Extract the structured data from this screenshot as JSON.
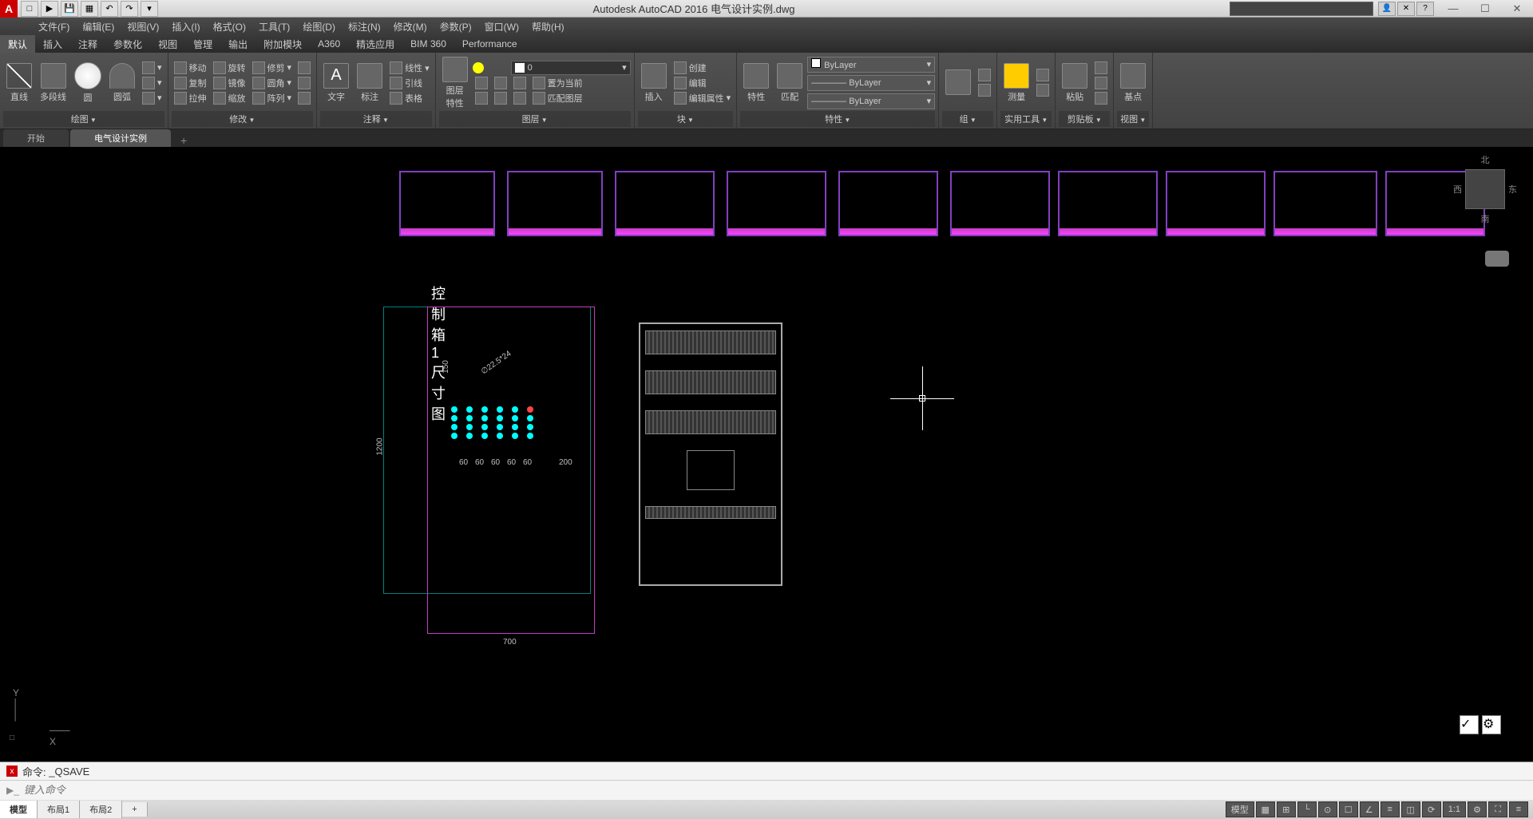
{
  "title": "Autodesk AutoCAD 2016   电气设计实例.dwg",
  "qat": [
    "□",
    "▶",
    "■",
    "▦",
    "↶",
    "↷",
    "▾"
  ],
  "menu": [
    "文件(F)",
    "编辑(E)",
    "视图(V)",
    "插入(I)",
    "格式(O)",
    "工具(T)",
    "绘图(D)",
    "标注(N)",
    "修改(M)",
    "参数(P)",
    "窗口(W)",
    "帮助(H)"
  ],
  "ribbon_tabs": [
    "默认",
    "插入",
    "注释",
    "参数化",
    "视图",
    "管理",
    "输出",
    "附加模块",
    "A360",
    "精选应用",
    "BIM 360",
    "Performance"
  ],
  "active_ribbon_tab": "默认",
  "panels": {
    "draw": {
      "title": "绘图",
      "items": [
        "直线",
        "多段线",
        "圆",
        "圆弧"
      ]
    },
    "modify": {
      "title": "修改",
      "items": [
        "移动",
        "旋转",
        "修剪",
        "复制",
        "镜像",
        "圆角",
        "拉伸",
        "缩放",
        "阵列"
      ]
    },
    "annotate": {
      "title": "注释",
      "items": [
        "文字",
        "标注",
        "引线",
        "表格"
      ]
    },
    "layers": {
      "title": "图层",
      "current": "0",
      "items": [
        "置为当前",
        "匹配图层"
      ]
    },
    "block": {
      "title": "块",
      "items": [
        "插入",
        "创建",
        "编辑",
        "编辑属性"
      ]
    },
    "props": {
      "title": "特性",
      "bylayer": "ByLayer",
      "items": [
        "特性",
        "特性匹配"
      ]
    },
    "group": {
      "title": "组"
    },
    "utils": {
      "title": "实用工具"
    },
    "clip": {
      "title": "剪贴板",
      "item": "粘贴"
    },
    "view": {
      "title": "视图",
      "item": "基点"
    }
  },
  "doc_tabs": {
    "start": "开始",
    "active": "电气设计实例"
  },
  "drawing": {
    "title": "控制箱1尺寸图",
    "dims": {
      "h": "1200",
      "w": "700",
      "d1": "60",
      "d2": "200",
      "top": "150",
      "angle": "∅22.5*24"
    }
  },
  "viewcube": {
    "n": "北",
    "s": "南",
    "e": "东",
    "w": "西"
  },
  "cmd": {
    "prompt": "命令:",
    "last": "_QSAVE",
    "placeholder": "键入命令"
  },
  "layout_tabs": [
    "模型",
    "布局1",
    "布局2"
  ],
  "status": {
    "model": "模型",
    "scale": "1:1"
  },
  "chart_data": null
}
